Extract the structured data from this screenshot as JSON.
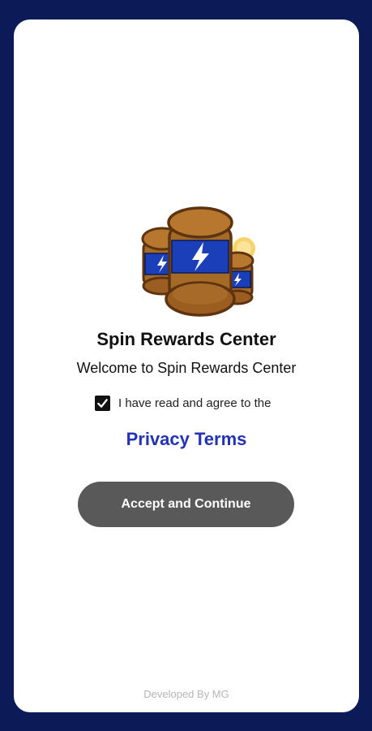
{
  "app": {
    "title": "Spin Rewards Center",
    "welcome": "Welcome to Spin Rewards Center",
    "logo_icon": "coin-stack-lightning-icon"
  },
  "consent": {
    "checkbox_checked": true,
    "label": "I have read and agree to the",
    "link_text": "Privacy Terms"
  },
  "actions": {
    "accept_label": "Accept and Continue"
  },
  "footer": {
    "text": "Developed By MG"
  },
  "colors": {
    "background": "#0c1a57",
    "card": "#ffffff",
    "link": "#2333b6",
    "button": "#595959",
    "footer_text": "#b5b5b5"
  }
}
